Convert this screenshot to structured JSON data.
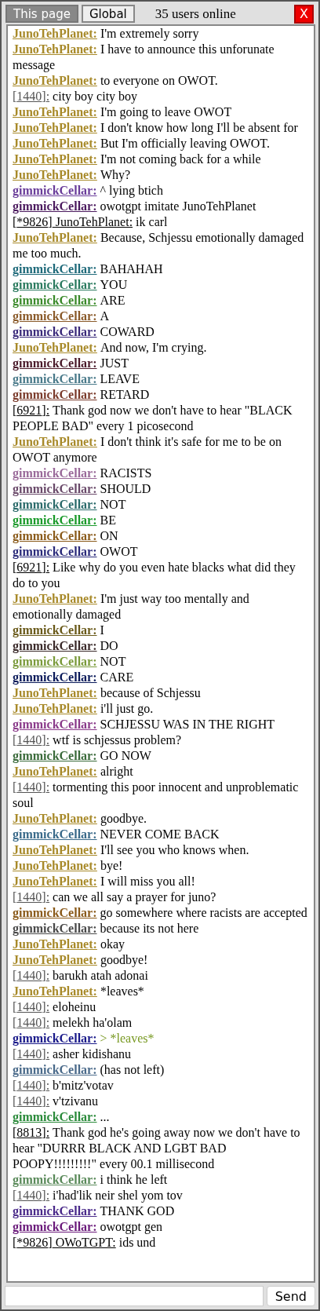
{
  "tabs": [
    {
      "label": "This page",
      "selected": true
    },
    {
      "label": "Global",
      "selected": false
    }
  ],
  "users_online": "35 users online",
  "close_label": "X",
  "messages": [
    {
      "kind": "user",
      "name": "JunoTehPlanet:",
      "color": "#a88a2a",
      "text": "I'm extremely sorry",
      "greentext": false
    },
    {
      "kind": "user",
      "name": "JunoTehPlanet:",
      "color": "#a88a2a",
      "text": "I have to announce this unforunate message",
      "greentext": false
    },
    {
      "kind": "user",
      "name": "JunoTehPlanet:",
      "color": "#a88a2a",
      "text": "to everyone on OWOT.",
      "greentext": false
    },
    {
      "kind": "anon",
      "sender": "[1440]:",
      "color": "#555555",
      "text": "city boy city boy",
      "greentext": false
    },
    {
      "kind": "user",
      "name": "JunoTehPlanet:",
      "color": "#a88a2a",
      "text": "I'm going to leave OWOT",
      "greentext": false
    },
    {
      "kind": "user",
      "name": "JunoTehPlanet:",
      "color": "#a88a2a",
      "text": "I don't know how long I'll be absent for",
      "greentext": false
    },
    {
      "kind": "user",
      "name": "JunoTehPlanet:",
      "color": "#a88a2a",
      "text": "But I'm officially leaving OWOT.",
      "greentext": false
    },
    {
      "kind": "user",
      "name": "JunoTehPlanet:",
      "color": "#a88a2a",
      "text": "I'm not coming back for a while",
      "greentext": false
    },
    {
      "kind": "user",
      "name": "JunoTehPlanet:",
      "color": "#a88a2a",
      "text": "Why?",
      "greentext": false
    },
    {
      "kind": "user",
      "name": "gimmickCellar:",
      "color": "#6a3d9a",
      "text": "^ lying btich",
      "greentext": false
    },
    {
      "kind": "user",
      "name": "gimmickCellar:",
      "color": "#4b1a5e",
      "text": "owotgpt imitate JunoTehPlanet",
      "greentext": false
    },
    {
      "kind": "bot",
      "sender": "[*9826] JunoTehPlanet:",
      "text": "ik carl",
      "greentext": false
    },
    {
      "kind": "user",
      "name": "JunoTehPlanet:",
      "color": "#a88a2a",
      "text": "Because, Schjessu emotionally damaged me too much.",
      "greentext": false
    },
    {
      "kind": "user",
      "name": "gimmickCellar:",
      "color": "#1f6a7a",
      "text": "BAHAHAH",
      "greentext": false
    },
    {
      "kind": "user",
      "name": "gimmickCellar:",
      "color": "#2a7a5e",
      "text": "YOU",
      "greentext": false
    },
    {
      "kind": "user",
      "name": "gimmickCellar:",
      "color": "#3a8a2a",
      "text": "ARE",
      "greentext": false
    },
    {
      "kind": "user",
      "name": "gimmickCellar:",
      "color": "#8a5a2a",
      "text": "A",
      "greentext": false
    },
    {
      "kind": "user",
      "name": "gimmickCellar:",
      "color": "#3a2a7a",
      "text": "COWARD",
      "greentext": false
    },
    {
      "kind": "user",
      "name": "JunoTehPlanet:",
      "color": "#a88a2a",
      "text": "And now, I'm crying.",
      "greentext": false
    },
    {
      "kind": "user",
      "name": "gimmickCellar:",
      "color": "#4a1a2a",
      "text": "JUST",
      "greentext": false
    },
    {
      "kind": "user",
      "name": "gimmickCellar:",
      "color": "#4a7a8a",
      "text": "LEAVE",
      "greentext": false
    },
    {
      "kind": "user",
      "name": "gimmickCellar:",
      "color": "#7a3a2a",
      "text": "RETARD",
      "greentext": false
    },
    {
      "kind": "anon",
      "sender": "[6921]:",
      "color": "#000000",
      "text": "Thank god now we don't have to hear \"BLACK PEOPLE BAD\" every 1 picosecond",
      "greentext": false
    },
    {
      "kind": "user",
      "name": "JunoTehPlanet:",
      "color": "#a88a2a",
      "text": "I don't think it's safe for me to be on OWOT anymore",
      "greentext": false
    },
    {
      "kind": "user",
      "name": "gimmickCellar:",
      "color": "#9a6a9a",
      "text": "RACISTS",
      "greentext": false
    },
    {
      "kind": "user",
      "name": "gimmickCellar:",
      "color": "#6a4a6a",
      "text": "SHOULD",
      "greentext": false
    },
    {
      "kind": "user",
      "name": "gimmickCellar:",
      "color": "#2a6a6a",
      "text": "NOT",
      "greentext": false
    },
    {
      "kind": "user",
      "name": "gimmickCellar:",
      "color": "#1a9a2a",
      "text": "BE",
      "greentext": false
    },
    {
      "kind": "user",
      "name": "gimmickCellar:",
      "color": "#8a5a1a",
      "text": "ON",
      "greentext": false
    },
    {
      "kind": "user",
      "name": "gimmickCellar:",
      "color": "#2a2a7a",
      "text": "OWOT",
      "greentext": false
    },
    {
      "kind": "anon",
      "sender": "[6921]:",
      "color": "#000000",
      "text": "Like why do you even hate blacks what did they do to you",
      "greentext": false
    },
    {
      "kind": "user",
      "name": "JunoTehPlanet:",
      "color": "#a88a2a",
      "text": "I'm just way too mentally and emotionally damaged",
      "greentext": false
    },
    {
      "kind": "user",
      "name": "gimmickCellar:",
      "color": "#6a5a1a",
      "text": "I",
      "greentext": false
    },
    {
      "kind": "user",
      "name": "gimmickCellar:",
      "color": "#3a2a2a",
      "text": "DO",
      "greentext": false
    },
    {
      "kind": "user",
      "name": "gimmickCellar:",
      "color": "#7a9a3a",
      "text": "NOT",
      "greentext": false
    },
    {
      "kind": "user",
      "name": "gimmickCellar:",
      "color": "#0a1a5a",
      "text": "CARE",
      "greentext": false
    },
    {
      "kind": "user",
      "name": "JunoTehPlanet:",
      "color": "#a88a2a",
      "text": "because of Schjessu",
      "greentext": false
    },
    {
      "kind": "user",
      "name": "JunoTehPlanet:",
      "color": "#a88a2a",
      "text": "i'll just go.",
      "greentext": false
    },
    {
      "kind": "user",
      "name": "gimmickCellar:",
      "color": "#8a3a8a",
      "text": "SCHJESSU WAS IN THE RIGHT",
      "greentext": false
    },
    {
      "kind": "anon",
      "sender": "[1440]:",
      "color": "#555555",
      "text": "wtf is schjessus problem?",
      "greentext": false
    },
    {
      "kind": "user",
      "name": "gimmickCellar:",
      "color": "#3a6a3a",
      "text": "GO NOW",
      "greentext": false
    },
    {
      "kind": "user",
      "name": "JunoTehPlanet:",
      "color": "#a88a2a",
      "text": "alright",
      "greentext": false
    },
    {
      "kind": "anon",
      "sender": "[1440]:",
      "color": "#555555",
      "text": "tormenting this poor innocent and unproblematic soul",
      "greentext": false
    },
    {
      "kind": "user",
      "name": "JunoTehPlanet:",
      "color": "#a88a2a",
      "text": "goodbye.",
      "greentext": false
    },
    {
      "kind": "user",
      "name": "gimmickCellar:",
      "color": "#3a6a8a",
      "text": "NEVER COME BACK",
      "greentext": false
    },
    {
      "kind": "user",
      "name": "JunoTehPlanet:",
      "color": "#a88a2a",
      "text": "I'll see you who knows when.",
      "greentext": false
    },
    {
      "kind": "user",
      "name": "JunoTehPlanet:",
      "color": "#a88a2a",
      "text": "bye!",
      "greentext": false
    },
    {
      "kind": "user",
      "name": "JunoTehPlanet:",
      "color": "#a88a2a",
      "text": "I will miss you all!",
      "greentext": false
    },
    {
      "kind": "anon",
      "sender": "[1440]:",
      "color": "#555555",
      "text": "can we all say a prayer for juno?",
      "greentext": false
    },
    {
      "kind": "user",
      "name": "gimmickCellar:",
      "color": "#8a5a1a",
      "text": "go somewhere where racists are accepted",
      "greentext": false
    },
    {
      "kind": "user",
      "name": "gimmickCellar:",
      "color": "#4a4a4a",
      "text": "because its not here",
      "greentext": false
    },
    {
      "kind": "user",
      "name": "JunoTehPlanet:",
      "color": "#a88a2a",
      "text": "okay",
      "greentext": false
    },
    {
      "kind": "user",
      "name": "JunoTehPlanet:",
      "color": "#a88a2a",
      "text": "goodbye!",
      "greentext": false
    },
    {
      "kind": "anon",
      "sender": "[1440]:",
      "color": "#555555",
      "text": "barukh atah adonai",
      "greentext": false
    },
    {
      "kind": "user",
      "name": "JunoTehPlanet:",
      "color": "#a88a2a",
      "text": "*leaves*",
      "greentext": false
    },
    {
      "kind": "anon",
      "sender": "[1440]:",
      "color": "#555555",
      "text": "eloheinu",
      "greentext": false
    },
    {
      "kind": "anon",
      "sender": "[1440]:",
      "color": "#555555",
      "text": "melekh ha'olam",
      "greentext": false
    },
    {
      "kind": "user",
      "name": "gimmickCellar:",
      "color": "#1a1a8a",
      "text": "> *leaves*",
      "greentext": true
    },
    {
      "kind": "anon",
      "sender": "[1440]:",
      "color": "#555555",
      "text": "asher kidishanu",
      "greentext": false
    },
    {
      "kind": "user",
      "name": "gimmickCellar:",
      "color": "#4a6a8a",
      "text": "(has not left)",
      "greentext": false
    },
    {
      "kind": "anon",
      "sender": "[1440]:",
      "color": "#555555",
      "text": "b'mitz'votav",
      "greentext": false
    },
    {
      "kind": "anon",
      "sender": "[1440]:",
      "color": "#555555",
      "text": "v'tzivanu",
      "greentext": false
    },
    {
      "kind": "user",
      "name": "gimmickCellar:",
      "color": "#2a8a3a",
      "text": "...",
      "greentext": false
    },
    {
      "kind": "anon",
      "sender": "[8813]:",
      "color": "#000000",
      "text": "Thank god he's going away now we don't have to hear \"DURRR BLACK AND LGBT BAD POOPY!!!!!!!!!\" every 00.1 millisecond",
      "greentext": false
    },
    {
      "kind": "user",
      "name": "gimmickCellar:",
      "color": "#5a8a5a",
      "text": "i think he left",
      "greentext": false
    },
    {
      "kind": "anon",
      "sender": "[1440]:",
      "color": "#555555",
      "text": "i'had'lik neir shel yom tov",
      "greentext": false
    },
    {
      "kind": "user",
      "name": "gimmickCellar:",
      "color": "#4a2a8a",
      "text": "THANK GOD",
      "greentext": false
    },
    {
      "kind": "user",
      "name": "gimmickCellar:",
      "color": "#6a1a7a",
      "text": "owotgpt gen",
      "greentext": false
    },
    {
      "kind": "bot",
      "sender": "[*9826] OWoTGPT:",
      "text": "ids und",
      "greentext": false
    }
  ],
  "send_label": "Send"
}
